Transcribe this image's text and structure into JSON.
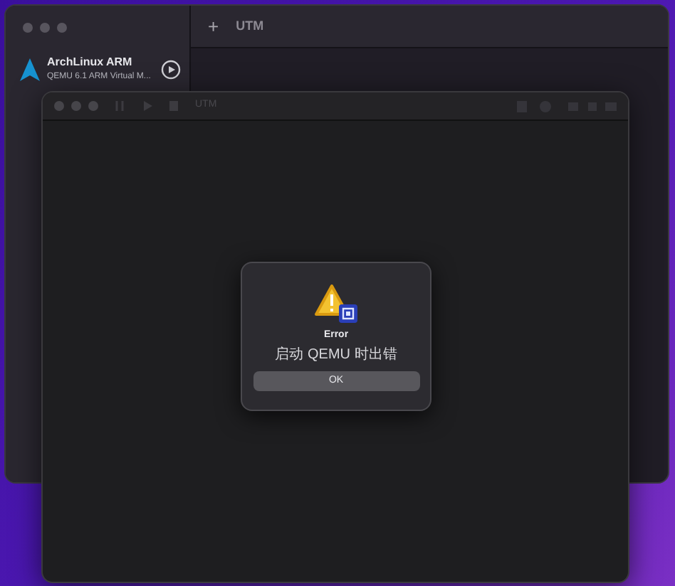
{
  "main_window": {
    "add": "+",
    "title": "UTM"
  },
  "vm_list": [
    {
      "name": "ArchLinux ARM",
      "subtitle": "QEMU 6.1 ARM Virtual M..."
    }
  ],
  "vm_window": {
    "title": "UTM"
  },
  "dialog": {
    "title": "Error",
    "message": "启动 QEMU 时出错",
    "button": "OK"
  }
}
